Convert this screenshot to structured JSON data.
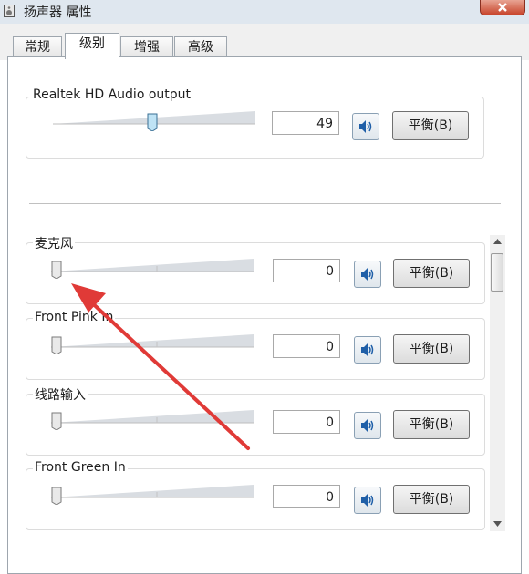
{
  "window": {
    "title": "扬声器 属性",
    "icon": "speaker-icon"
  },
  "tabs": [
    {
      "label": "常规",
      "active": false
    },
    {
      "label": "级别",
      "active": true
    },
    {
      "label": "增强",
      "active": false
    },
    {
      "label": "高级",
      "active": false
    }
  ],
  "master": {
    "label": "Realtek HD Audio output",
    "value": "49",
    "level": 0.49,
    "balance_label": "平衡(B)",
    "mute_icon": "speaker-volume-icon"
  },
  "channels": [
    {
      "label": "麦克风",
      "value": "0",
      "level": 0,
      "balance_label": "平衡(B)"
    },
    {
      "label": "Front Pink In",
      "value": "0",
      "level": 0,
      "balance_label": "平衡(B)"
    },
    {
      "label": "线路输入",
      "value": "0",
      "level": 0,
      "balance_label": "平衡(B)"
    },
    {
      "label": "Front Green In",
      "value": "0",
      "level": 0,
      "balance_label": "平衡(B)"
    }
  ],
  "colors": {
    "annotation_arrow": "#e03a37",
    "close_button": "#c8452c"
  }
}
